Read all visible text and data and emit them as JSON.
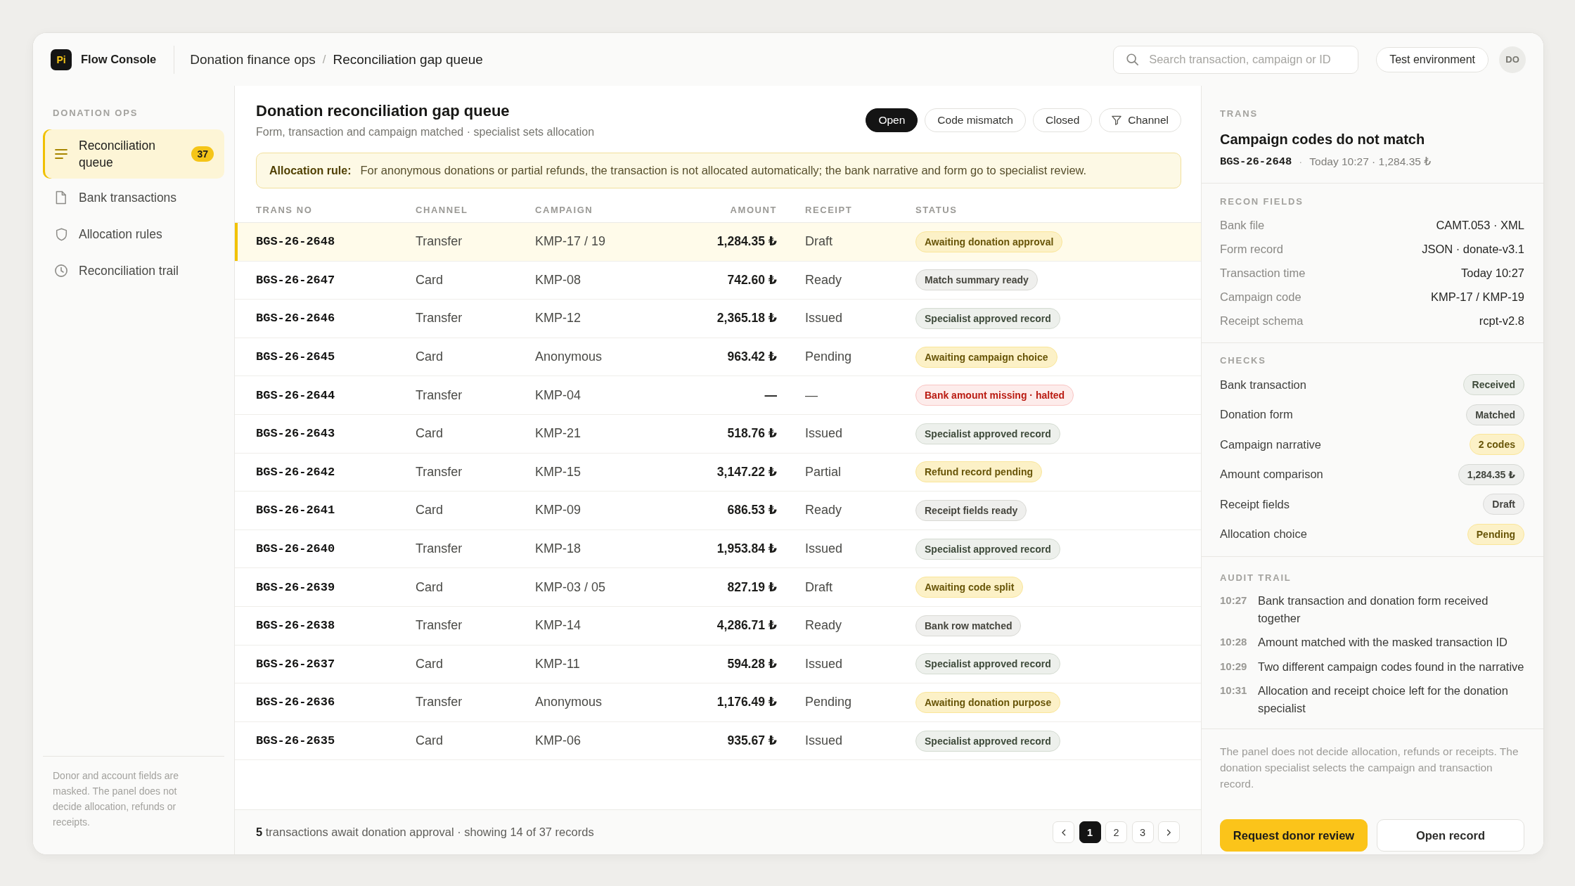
{
  "app": {
    "logo": "Pi",
    "name": "Flow Console"
  },
  "breadcrumbs": {
    "items": [
      "Donation finance ops",
      "Reconciliation gap queue"
    ],
    "separator": "/"
  },
  "search": {
    "placeholder": "Search transaction, campaign or ID"
  },
  "environment": "Test environment",
  "user": {
    "initials": "DO"
  },
  "sidebar": {
    "section": "DONATION OPS",
    "items": [
      {
        "label": "Reconciliation queue",
        "badge": "37",
        "selected": true
      },
      {
        "label": "Bank transactions",
        "selected": false
      },
      {
        "label": "Allocation rules",
        "selected": false
      },
      {
        "label": "Reconciliation trail",
        "selected": false
      }
    ],
    "footer": "Donor and account fields are masked. The panel does not decide allocation, refunds or receipts."
  },
  "queue": {
    "title": "Donation reconciliation gap queue",
    "subtitle": "Form, transaction and campaign matched · specialist sets allocation",
    "filters": [
      {
        "label": "Open",
        "selected": true
      },
      {
        "label": "Code mismatch",
        "selected": false
      },
      {
        "label": "Closed",
        "selected": false
      }
    ],
    "channel_filter": {
      "label": "Channel"
    },
    "rule": {
      "label": "Allocation rule:",
      "text": "For anonymous donations or partial refunds, the transaction is not allocated automatically; the bank narrative and form go to specialist review."
    },
    "table": {
      "columns": [
        "TRANS NO",
        "CHANNEL",
        "CAMPAIGN",
        "AMOUNT",
        "RECEIPT",
        "STATUS"
      ],
      "rows": [
        {
          "trans_no": "BGS-26-2648",
          "channel": "Transfer",
          "campaign": "KMP-17 / 19",
          "amount": "1,284.35 ₺",
          "receipt": "Draft",
          "status": {
            "label": "Awaiting donation approval",
            "color": "#fcf1c7"
          },
          "selected": true
        },
        {
          "trans_no": "BGS-26-2647",
          "channel": "Card",
          "campaign": "KMP-08",
          "amount": "742.60 ₺",
          "receipt": "Ready",
          "status": {
            "label": "Match summary ready",
            "color": "#efefed"
          },
          "selected": false
        },
        {
          "trans_no": "BGS-26-2646",
          "channel": "Transfer",
          "campaign": "KMP-12",
          "amount": "2,365.18 ₺",
          "receipt": "Issued",
          "status": {
            "label": "Specialist approved record",
            "color": "#edf0ec"
          },
          "selected": false
        },
        {
          "trans_no": "BGS-26-2645",
          "channel": "Card",
          "campaign": "Anonymous",
          "amount": "963.42 ₺",
          "receipt": "Pending",
          "status": {
            "label": "Awaiting campaign choice",
            "color": "#fcf1c7"
          },
          "selected": false
        },
        {
          "trans_no": "BGS-26-2644",
          "channel": "Transfer",
          "campaign": "KMP-04",
          "amount": "—",
          "receipt": "—",
          "status": {
            "label": "Bank amount missing · halted",
            "color": "#fdeceb"
          },
          "selected": false
        },
        {
          "trans_no": "BGS-26-2643",
          "channel": "Card",
          "campaign": "KMP-21",
          "amount": "518.76 ₺",
          "receipt": "Issued",
          "status": {
            "label": "Specialist approved record",
            "color": "#edf0ec"
          },
          "selected": false
        },
        {
          "trans_no": "BGS-26-2642",
          "channel": "Transfer",
          "campaign": "KMP-15",
          "amount": "3,147.22 ₺",
          "receipt": "Partial",
          "status": {
            "label": "Refund record pending",
            "color": "#fcf1c7"
          },
          "selected": false
        },
        {
          "trans_no": "BGS-26-2641",
          "channel": "Card",
          "campaign": "KMP-09",
          "amount": "686.53 ₺",
          "receipt": "Ready",
          "status": {
            "label": "Receipt fields ready",
            "color": "#efefed"
          },
          "selected": false
        },
        {
          "trans_no": "BGS-26-2640",
          "channel": "Transfer",
          "campaign": "KMP-18",
          "amount": "1,953.84 ₺",
          "receipt": "Issued",
          "status": {
            "label": "Specialist approved record",
            "color": "#edf0ec"
          },
          "selected": false
        },
        {
          "trans_no": "BGS-26-2639",
          "channel": "Card",
          "campaign": "KMP-03 / 05",
          "amount": "827.19 ₺",
          "receipt": "Draft",
          "status": {
            "label": "Awaiting code split",
            "color": "#fcf1c7"
          },
          "selected": false
        },
        {
          "trans_no": "BGS-26-2638",
          "channel": "Transfer",
          "campaign": "KMP-14",
          "amount": "4,286.71 ₺",
          "receipt": "Ready",
          "status": {
            "label": "Bank row matched",
            "color": "#efefed"
          },
          "selected": false
        },
        {
          "trans_no": "BGS-26-2637",
          "channel": "Card",
          "campaign": "KMP-11",
          "amount": "594.28 ₺",
          "receipt": "Issued",
          "status": {
            "label": "Specialist approved record",
            "color": "#edf0ec"
          },
          "selected": false
        },
        {
          "trans_no": "BGS-26-2636",
          "channel": "Transfer",
          "campaign": "Anonymous",
          "amount": "1,176.49 ₺",
          "receipt": "Pending",
          "status": {
            "label": "Awaiting donation purpose",
            "color": "#fcf1c7"
          },
          "selected": false
        },
        {
          "trans_no": "BGS-26-2635",
          "channel": "Card",
          "campaign": "KMP-06",
          "amount": "935.67 ₺",
          "receipt": "Issued",
          "status": {
            "label": "Specialist approved record",
            "color": "#edf0ec"
          },
          "selected": false
        }
      ]
    },
    "footer": {
      "summary": "**5** transactions await donation approval · showing 14 of 37 records",
      "pages": [
        {
          "label": "1",
          "selected": true
        },
        {
          "label": "2",
          "selected": false
        },
        {
          "label": "3",
          "selected": false
        }
      ]
    }
  },
  "detail": {
    "eyebrow": "TRANS",
    "title": "Campaign codes do not match",
    "id": "BGS-26-2648",
    "separator": "·",
    "meta": "Today 10:27 · 1,284.35 ₺",
    "fields": {
      "heading": "RECON FIELDS",
      "items": [
        {
          "label": "Bank file",
          "value": "CAMT.053 · XML"
        },
        {
          "label": "Form record",
          "value": "JSON · donate-v3.1"
        },
        {
          "label": "Transaction time",
          "value": "Today 10:27"
        },
        {
          "label": "Campaign code",
          "value": "KMP-17 / KMP-19"
        },
        {
          "label": "Receipt schema",
          "value": "rcpt-v2.8"
        }
      ]
    },
    "checks": {
      "heading": "CHECKS",
      "items": [
        {
          "label": "Bank transaction",
          "status": "Received",
          "color": "#edf0ec"
        },
        {
          "label": "Donation form",
          "status": "Matched",
          "color": "#eeefed"
        },
        {
          "label": "Campaign narrative",
          "status": "2 codes",
          "color": "#fcf1c7"
        },
        {
          "label": "Amount comparison",
          "status": "1,284.35 ₺",
          "color": "#eeefed"
        },
        {
          "label": "Receipt fields",
          "status": "Draft",
          "color": "#f0f0ef"
        },
        {
          "label": "Allocation choice",
          "status": "Pending",
          "color": "#fcf1c7"
        }
      ]
    },
    "audit": {
      "heading": "AUDIT TRAIL",
      "items": [
        {
          "time": "10:27",
          "text": "Bank transaction and donation form received together"
        },
        {
          "time": "10:28",
          "text": "Amount matched with the masked transaction ID"
        },
        {
          "time": "10:29",
          "text": "Two different campaign codes found in the narrative"
        },
        {
          "time": "10:31",
          "text": "Allocation and receipt choice left for the donation specialist"
        }
      ]
    },
    "note": "The panel does not decide allocation, refunds or receipts. The donation specialist selects the campaign and transaction record.",
    "actions": [
      {
        "label": "Request donor review",
        "kind": "primary"
      },
      {
        "label": "Open record",
        "kind": "secondary"
      }
    ]
  }
}
